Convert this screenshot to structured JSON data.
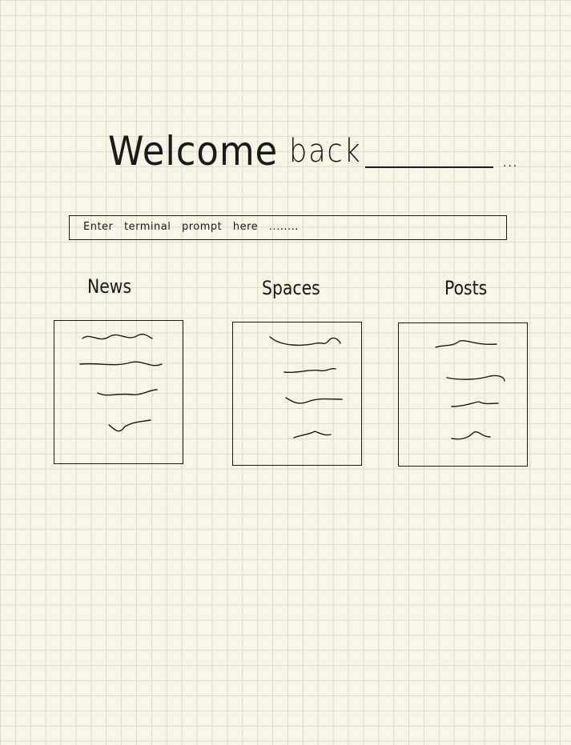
{
  "header": {
    "welcome_word": "Welcome",
    "back_word": "back",
    "name_placeholder_suffix": "..."
  },
  "prompt": {
    "placeholder": "Enter terminal prompt here ........"
  },
  "sections": [
    {
      "title": "News"
    },
    {
      "title": "Spaces"
    },
    {
      "title": "Posts"
    }
  ],
  "colors": {
    "paper": "#f7f5e8",
    "grid": "#dcdccb",
    "ink": "#1a1a1a"
  }
}
